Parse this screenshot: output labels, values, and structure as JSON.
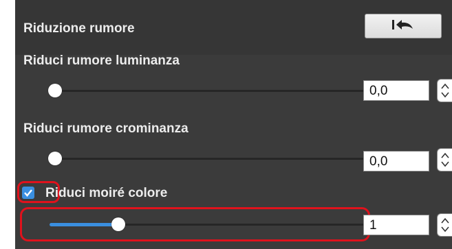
{
  "noise_reduction": {
    "title": "Riduzione rumore",
    "reset_icon": "reset-to-default-icon",
    "luminance": {
      "label": "Riduci rumore luminanza",
      "value": "0,0",
      "slider_fraction": 0.0
    },
    "chrominance": {
      "label": "Riduci rumore crominanza",
      "value": "0,0",
      "slider_fraction": 0.0
    },
    "moire": {
      "label": "Riduci moiré colore",
      "checked": true,
      "value": "1",
      "slider_fraction": 0.22
    }
  },
  "colors": {
    "panel_bg": "#3b3b3b",
    "accent": "#3a8fe0",
    "highlight": "#e0121c"
  }
}
